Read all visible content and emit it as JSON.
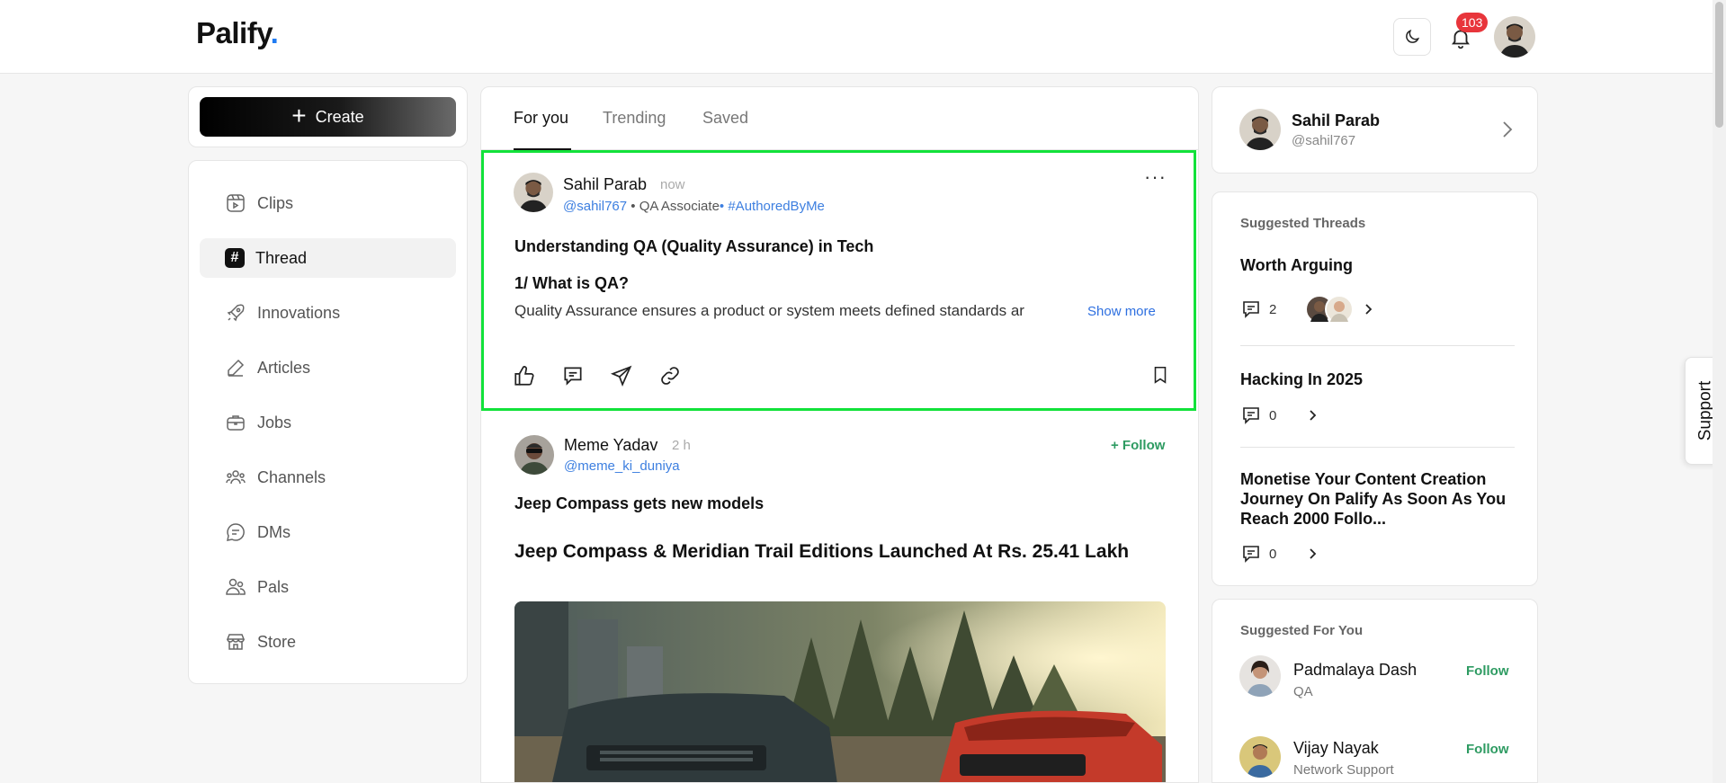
{
  "header": {
    "logo_text": "Palify",
    "logo_dot": ".",
    "notification_count": "103"
  },
  "create_label": "Create",
  "sidebar": {
    "items": [
      {
        "label": "Clips",
        "icon": "clips-icon"
      },
      {
        "label": "Thread",
        "icon": "hash-icon",
        "active": true
      },
      {
        "label": "Innovations",
        "icon": "rocket-icon"
      },
      {
        "label": "Articles",
        "icon": "pen-icon"
      },
      {
        "label": "Jobs",
        "icon": "briefcase-icon"
      },
      {
        "label": "Channels",
        "icon": "users-group-icon"
      },
      {
        "label": "DMs",
        "icon": "chat-icon"
      },
      {
        "label": "Pals",
        "icon": "pals-icon"
      },
      {
        "label": "Store",
        "icon": "store-icon"
      }
    ]
  },
  "feed": {
    "tabs": [
      "For you",
      "Trending",
      "Saved"
    ],
    "active_tab": "For you",
    "posts": [
      {
        "author": "Sahil Parab",
        "time": "now",
        "handle": "@sahil767",
        "role_sep": " • QA Associate",
        "tag": "• #AuthoredByMe",
        "title": "Understanding QA (Quality Assurance) in Tech",
        "subtitle": "1/ What is QA?",
        "text": "Quality Assurance ensures a product or system meets defined standards ar",
        "show_more": "Show more",
        "more": "···"
      },
      {
        "author": "Meme Yadav",
        "time": "2 h",
        "handle": "@meme_ki_duniya",
        "follow": "+ Follow",
        "title": "Jeep Compass gets new models",
        "headline": "Jeep Compass & Meridian Trail Editions Launched At Rs. 25.41 Lakh"
      }
    ]
  },
  "right": {
    "profile": {
      "name": "Sahil Parab",
      "handle": "@sahil767"
    },
    "threads_heading": "Suggested Threads",
    "threads": [
      {
        "title": "Worth Arguing",
        "count": "2"
      },
      {
        "title": "Hacking In 2025",
        "count": "0"
      },
      {
        "title": "Monetise Your Content Creation Journey On Palify As Soon As You Reach 2000 Follo...",
        "count": "0"
      }
    ],
    "suggest_heading": "Suggested For You",
    "suggestions": [
      {
        "name": "Padmalaya Dash",
        "role": "QA",
        "follow": "Follow"
      },
      {
        "name": "Vijay Nayak",
        "role": "Network Support",
        "follow": "Follow"
      }
    ]
  },
  "support_label": "Support",
  "colors": {
    "accent_green": "#2e9b62",
    "link_blue": "#3d7fe0",
    "highlight": "#12e23a",
    "badge": "#e8353b"
  }
}
